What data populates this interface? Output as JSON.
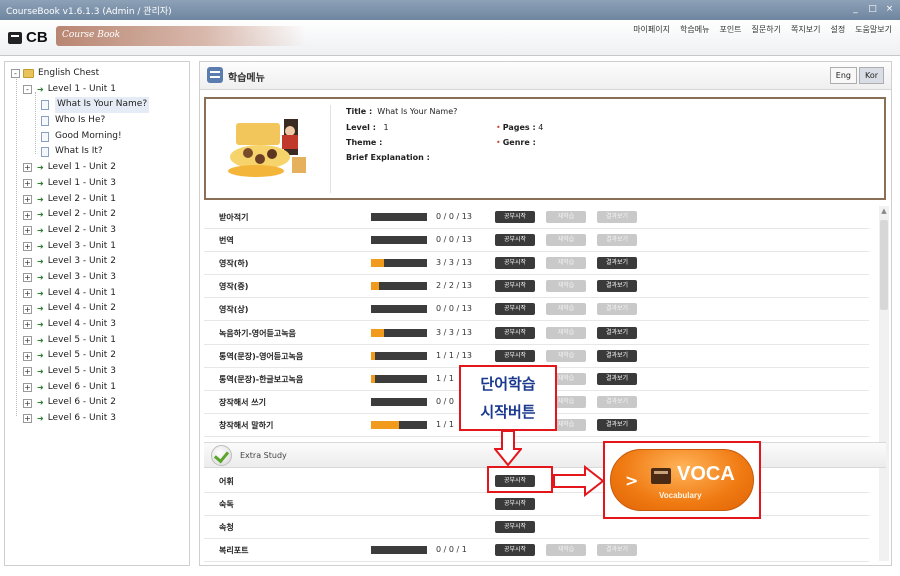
{
  "window": {
    "title": "CourseBook v1.6.1.3 (Admin / 관리자)",
    "controls": [
      "_",
      "□",
      "×"
    ]
  },
  "header": {
    "brand": "CB",
    "brand_sub": "Course Book",
    "menu": [
      "마이페이지",
      "학습메뉴",
      "포인트",
      "질문하기",
      "쪽지보기",
      "설정",
      "도움말보기"
    ]
  },
  "tree": {
    "root": "English Chest",
    "levels": [
      {
        "label": "Level 1 - Unit 1",
        "expander": "-",
        "lessons": [
          "What Is Your Name?",
          "Who Is He?",
          "Good Morning!",
          "What Is It?"
        ]
      },
      {
        "label": "Level 1 - Unit 2",
        "expander": "+"
      },
      {
        "label": "Level 1 - Unit 3",
        "expander": "+"
      },
      {
        "label": "Level 2 - Unit 1",
        "expander": "+"
      },
      {
        "label": "Level 2 - Unit 2",
        "expander": "+"
      },
      {
        "label": "Level 2 - Unit 3",
        "expander": "+"
      },
      {
        "label": "Level 3 - Unit 1",
        "expander": "+"
      },
      {
        "label": "Level 3 - Unit 2",
        "expander": "+"
      },
      {
        "label": "Level 3 - Unit 3",
        "expander": "+"
      },
      {
        "label": "Level 4 - Unit 1",
        "expander": "+"
      },
      {
        "label": "Level 4 - Unit 2",
        "expander": "+"
      },
      {
        "label": "Level 4 - Unit 3",
        "expander": "+"
      },
      {
        "label": "Level 5 - Unit 1",
        "expander": "+"
      },
      {
        "label": "Level 5 - Unit 2",
        "expander": "+"
      },
      {
        "label": "Level 5 - Unit 3",
        "expander": "+"
      },
      {
        "label": "Level 6 - Unit 1",
        "expander": "+"
      },
      {
        "label": "Level 6 - Unit 2",
        "expander": "+"
      },
      {
        "label": "Level 6 - Unit 3",
        "expander": "+"
      }
    ]
  },
  "main": {
    "title": "학습메뉴",
    "lang": {
      "eng": "Eng",
      "kor": "Kor"
    }
  },
  "info": {
    "title_label": "Title :",
    "title_value": "What Is Your Name?",
    "level_label": "Level :",
    "level_value": "1",
    "pages_label": "Pages :",
    "pages_value": "4",
    "theme_label": "Theme :",
    "theme_value": "",
    "genre_label": "Genre :",
    "genre_value": "",
    "brief_label": "Brief Explanation :",
    "brief_value": ""
  },
  "study_buttons": {
    "start": "공부시작",
    "review": "재학습",
    "result": "결과보기"
  },
  "study_rows": [
    {
      "label": "받아적기",
      "progress": 0,
      "count": "0 / 0 / 13",
      "result_active": false
    },
    {
      "label": "번역",
      "progress": 0,
      "count": "0 / 0 / 13",
      "result_active": false
    },
    {
      "label": "영작(하)",
      "progress": 0.23,
      "count": "3 / 3 / 13",
      "result_active": true
    },
    {
      "label": "영작(중)",
      "progress": 0.15,
      "count": "2 / 2 / 13",
      "result_active": true
    },
    {
      "label": "영작(상)",
      "progress": 0,
      "count": "0 / 0 / 13",
      "result_active": false
    },
    {
      "label": "녹음하기-영어듣고녹음",
      "progress": 0.23,
      "count": "3 / 3 / 13",
      "result_active": true
    },
    {
      "label": "통역(문장)-영어듣고녹음",
      "progress": 0.08,
      "count": "1 / 1 / 13",
      "result_active": true
    },
    {
      "label": "통역(문장)-한글보고녹음",
      "progress": 0.08,
      "count": "1 / 1",
      "result_active": true
    },
    {
      "label": "장작해서 쓰기",
      "progress": 0,
      "count": "0 / 0",
      "result_active": false
    },
    {
      "label": "창작해서 말하기",
      "progress": 0.5,
      "count": "1 / 1",
      "result_active": true
    }
  ],
  "extra": {
    "title": "Extra Study",
    "rows": [
      {
        "label": "어휘"
      },
      {
        "label": "숙독"
      },
      {
        "label": "속청"
      }
    ],
    "review_row": {
      "label": "복리포트",
      "count": "0 / 0 / 1"
    }
  },
  "callout": {
    "line1": "단어학습",
    "line2": "시작버튼"
  },
  "voca": {
    "title": "VOCA",
    "subtitle": "Vocabulary",
    "color": "#f07a12"
  },
  "colors": {
    "highlight": "#e3171b",
    "progress": "#f29a1c",
    "callout_text": "#1b3a8f"
  }
}
